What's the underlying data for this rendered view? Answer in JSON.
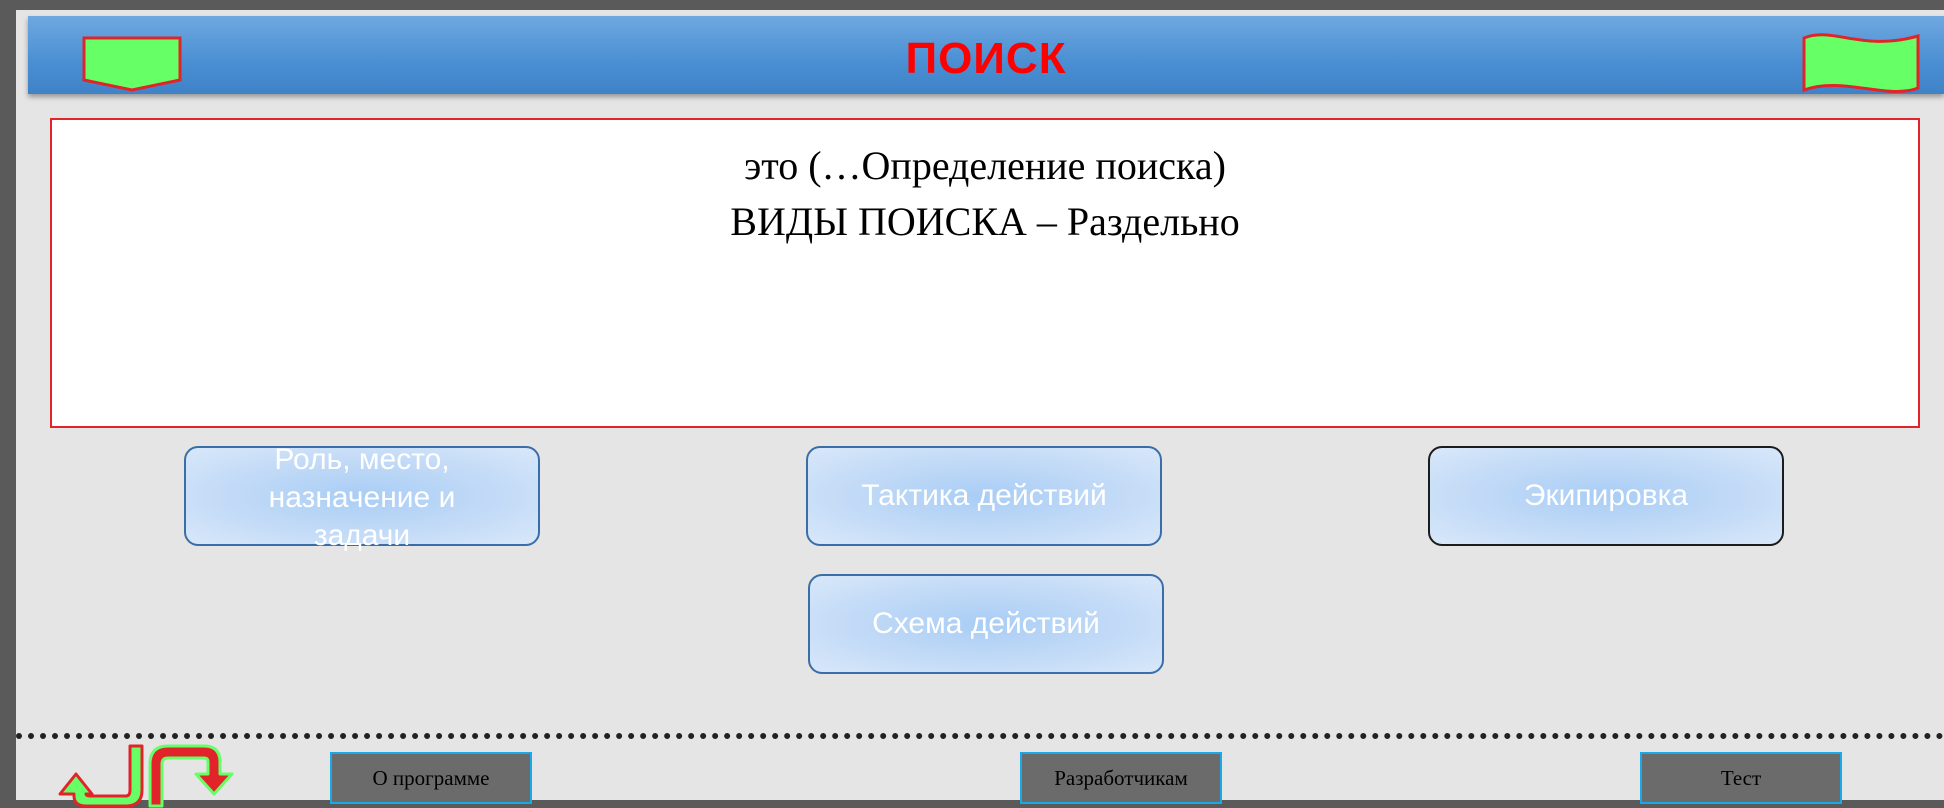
{
  "header": {
    "title": "ПОИСК",
    "left_icon": "pentagon-tag-icon",
    "right_icon": "wave-flag-icon"
  },
  "content": {
    "line1": "это (…Определение поиска)",
    "line2": "ВИДЫ ПОИСКА – Раздельно"
  },
  "nav_buttons": {
    "role": "Роль, место, назначение и задачи",
    "tactics": "Тактика действий",
    "equipment": "Экипировка",
    "scheme": "Схема действий"
  },
  "footer": {
    "about": "О программе",
    "developers": "Разработчикам",
    "test": "Тест",
    "back_icon": "u-turn-back-arrow-icon",
    "forward_icon": "u-turn-forward-arrow-icon"
  },
  "colors": {
    "title": "#ff0000",
    "header_blue": "#4a8fd3",
    "icon_green": "#66ff66",
    "border_red": "#e0242a",
    "footer_border": "#1aa8e8"
  }
}
